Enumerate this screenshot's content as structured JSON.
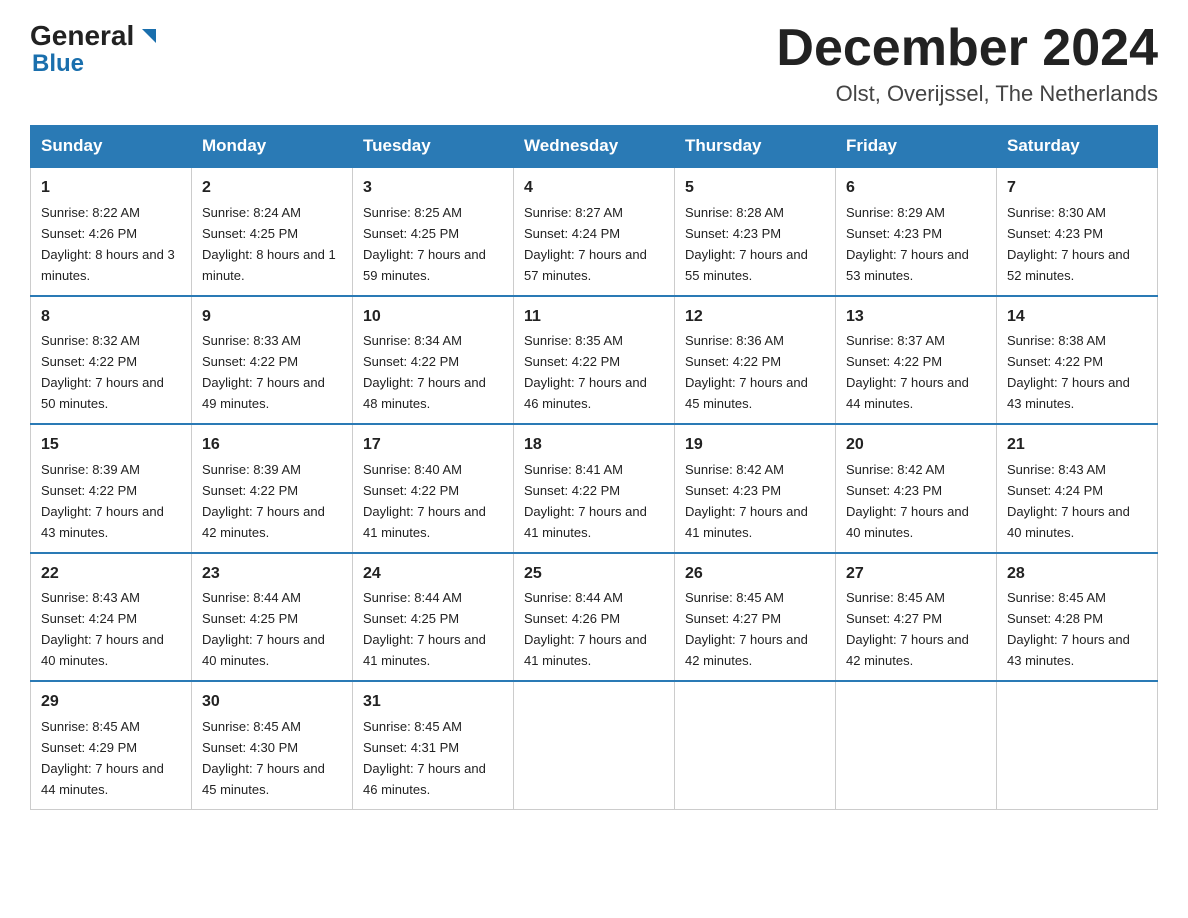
{
  "header": {
    "logo_text1": "General",
    "logo_text2": "Blue",
    "month_title": "December 2024",
    "location": "Olst, Overijssel, The Netherlands"
  },
  "days_of_week": [
    "Sunday",
    "Monday",
    "Tuesday",
    "Wednesday",
    "Thursday",
    "Friday",
    "Saturday"
  ],
  "weeks": [
    [
      {
        "day": "1",
        "sunrise": "8:22 AM",
        "sunset": "4:26 PM",
        "daylight": "8 hours and 3 minutes."
      },
      {
        "day": "2",
        "sunrise": "8:24 AM",
        "sunset": "4:25 PM",
        "daylight": "8 hours and 1 minute."
      },
      {
        "day": "3",
        "sunrise": "8:25 AM",
        "sunset": "4:25 PM",
        "daylight": "7 hours and 59 minutes."
      },
      {
        "day": "4",
        "sunrise": "8:27 AM",
        "sunset": "4:24 PM",
        "daylight": "7 hours and 57 minutes."
      },
      {
        "day": "5",
        "sunrise": "8:28 AM",
        "sunset": "4:23 PM",
        "daylight": "7 hours and 55 minutes."
      },
      {
        "day": "6",
        "sunrise": "8:29 AM",
        "sunset": "4:23 PM",
        "daylight": "7 hours and 53 minutes."
      },
      {
        "day": "7",
        "sunrise": "8:30 AM",
        "sunset": "4:23 PM",
        "daylight": "7 hours and 52 minutes."
      }
    ],
    [
      {
        "day": "8",
        "sunrise": "8:32 AM",
        "sunset": "4:22 PM",
        "daylight": "7 hours and 50 minutes."
      },
      {
        "day": "9",
        "sunrise": "8:33 AM",
        "sunset": "4:22 PM",
        "daylight": "7 hours and 49 minutes."
      },
      {
        "day": "10",
        "sunrise": "8:34 AM",
        "sunset": "4:22 PM",
        "daylight": "7 hours and 48 minutes."
      },
      {
        "day": "11",
        "sunrise": "8:35 AM",
        "sunset": "4:22 PM",
        "daylight": "7 hours and 46 minutes."
      },
      {
        "day": "12",
        "sunrise": "8:36 AM",
        "sunset": "4:22 PM",
        "daylight": "7 hours and 45 minutes."
      },
      {
        "day": "13",
        "sunrise": "8:37 AM",
        "sunset": "4:22 PM",
        "daylight": "7 hours and 44 minutes."
      },
      {
        "day": "14",
        "sunrise": "8:38 AM",
        "sunset": "4:22 PM",
        "daylight": "7 hours and 43 minutes."
      }
    ],
    [
      {
        "day": "15",
        "sunrise": "8:39 AM",
        "sunset": "4:22 PM",
        "daylight": "7 hours and 43 minutes."
      },
      {
        "day": "16",
        "sunrise": "8:39 AM",
        "sunset": "4:22 PM",
        "daylight": "7 hours and 42 minutes."
      },
      {
        "day": "17",
        "sunrise": "8:40 AM",
        "sunset": "4:22 PM",
        "daylight": "7 hours and 41 minutes."
      },
      {
        "day": "18",
        "sunrise": "8:41 AM",
        "sunset": "4:22 PM",
        "daylight": "7 hours and 41 minutes."
      },
      {
        "day": "19",
        "sunrise": "8:42 AM",
        "sunset": "4:23 PM",
        "daylight": "7 hours and 41 minutes."
      },
      {
        "day": "20",
        "sunrise": "8:42 AM",
        "sunset": "4:23 PM",
        "daylight": "7 hours and 40 minutes."
      },
      {
        "day": "21",
        "sunrise": "8:43 AM",
        "sunset": "4:24 PM",
        "daylight": "7 hours and 40 minutes."
      }
    ],
    [
      {
        "day": "22",
        "sunrise": "8:43 AM",
        "sunset": "4:24 PM",
        "daylight": "7 hours and 40 minutes."
      },
      {
        "day": "23",
        "sunrise": "8:44 AM",
        "sunset": "4:25 PM",
        "daylight": "7 hours and 40 minutes."
      },
      {
        "day": "24",
        "sunrise": "8:44 AM",
        "sunset": "4:25 PM",
        "daylight": "7 hours and 41 minutes."
      },
      {
        "day": "25",
        "sunrise": "8:44 AM",
        "sunset": "4:26 PM",
        "daylight": "7 hours and 41 minutes."
      },
      {
        "day": "26",
        "sunrise": "8:45 AM",
        "sunset": "4:27 PM",
        "daylight": "7 hours and 42 minutes."
      },
      {
        "day": "27",
        "sunrise": "8:45 AM",
        "sunset": "4:27 PM",
        "daylight": "7 hours and 42 minutes."
      },
      {
        "day": "28",
        "sunrise": "8:45 AM",
        "sunset": "4:28 PM",
        "daylight": "7 hours and 43 minutes."
      }
    ],
    [
      {
        "day": "29",
        "sunrise": "8:45 AM",
        "sunset": "4:29 PM",
        "daylight": "7 hours and 44 minutes."
      },
      {
        "day": "30",
        "sunrise": "8:45 AM",
        "sunset": "4:30 PM",
        "daylight": "7 hours and 45 minutes."
      },
      {
        "day": "31",
        "sunrise": "8:45 AM",
        "sunset": "4:31 PM",
        "daylight": "7 hours and 46 minutes."
      },
      null,
      null,
      null,
      null
    ]
  ]
}
